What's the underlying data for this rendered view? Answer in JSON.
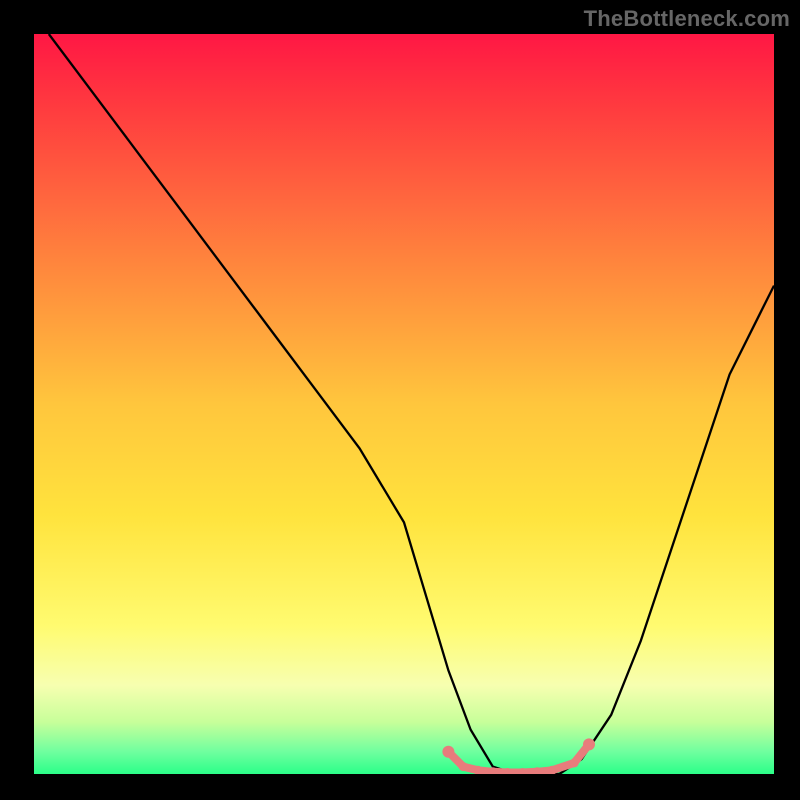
{
  "watermark": "TheBottleneck.com",
  "chart_data": {
    "type": "line",
    "title": "",
    "xlabel": "",
    "ylabel": "",
    "xlim": [
      0,
      100
    ],
    "ylim": [
      0,
      100
    ],
    "background_gradient_stops": [
      {
        "offset": 0,
        "color": "#ff1744"
      },
      {
        "offset": 0.1,
        "color": "#ff3b3f"
      },
      {
        "offset": 0.3,
        "color": "#ff823d"
      },
      {
        "offset": 0.5,
        "color": "#ffc63d"
      },
      {
        "offset": 0.65,
        "color": "#ffe33d"
      },
      {
        "offset": 0.8,
        "color": "#fffb70"
      },
      {
        "offset": 0.88,
        "color": "#f7ffb0"
      },
      {
        "offset": 0.93,
        "color": "#c7ff9a"
      },
      {
        "offset": 0.97,
        "color": "#6fff9f"
      },
      {
        "offset": 1.0,
        "color": "#2bff89"
      }
    ],
    "series": [
      {
        "name": "bottleneck-curve",
        "x": [
          2,
          8,
          14,
          20,
          26,
          32,
          38,
          44,
          50,
          53,
          56,
          59,
          62,
          65,
          68,
          71,
          74,
          78,
          82,
          86,
          90,
          94,
          98,
          100
        ],
        "y": [
          100,
          92,
          84,
          76,
          68,
          60,
          52,
          44,
          34,
          24,
          14,
          6,
          1,
          0,
          0,
          0,
          2,
          8,
          18,
          30,
          42,
          54,
          62,
          66
        ]
      }
    ],
    "markers": {
      "name": "highlight-range",
      "color": "#e87c7c",
      "points": [
        {
          "x": 56,
          "y": 3
        },
        {
          "x": 58,
          "y": 1
        },
        {
          "x": 60,
          "y": 0.5
        },
        {
          "x": 62,
          "y": 0.3
        },
        {
          "x": 64,
          "y": 0.2
        },
        {
          "x": 66,
          "y": 0.2
        },
        {
          "x": 68,
          "y": 0.3
        },
        {
          "x": 70,
          "y": 0.5
        },
        {
          "x": 73,
          "y": 1.5
        },
        {
          "x": 75,
          "y": 4
        }
      ]
    }
  }
}
